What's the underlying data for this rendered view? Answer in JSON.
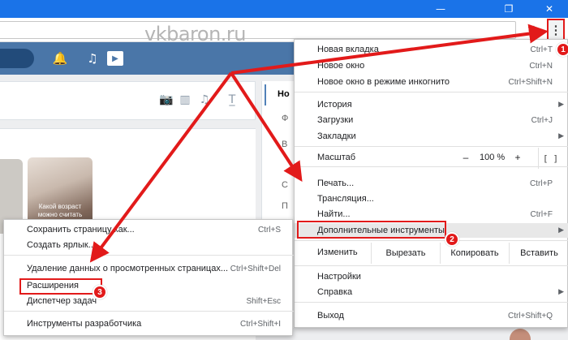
{
  "watermark": "vkbaron.ru",
  "window_controls": {
    "minimize": "—",
    "restore": "❐",
    "close": "✕"
  },
  "toolbar": {
    "star_icon": "☆",
    "menu_icon": "⋮"
  },
  "vk_header": {
    "bell_icon": "🔔",
    "music_icon": "♫",
    "video_icon": "▶"
  },
  "post_icons": [
    "📷",
    "▥",
    "♫",
    "T̲"
  ],
  "feed": {
    "thumbnail_caption": "Какой возраст можно считать оптимальным"
  },
  "right_column": {
    "tab_label": "Но",
    "letters": [
      "Ф",
      "В",
      "С",
      "П"
    ]
  },
  "main_menu": {
    "new_tab": {
      "label": "Новая вкладка",
      "shortcut": "Ctrl+T"
    },
    "new_window": {
      "label": "Новое окно",
      "shortcut": "Ctrl+N"
    },
    "incognito": {
      "label": "Новое окно в режиме инкогнито",
      "shortcut": "Ctrl+Shift+N"
    },
    "history": {
      "label": "История"
    },
    "downloads": {
      "label": "Загрузки",
      "shortcut": "Ctrl+J"
    },
    "bookmarks": {
      "label": "Закладки"
    },
    "zoom": {
      "label": "Масштаб",
      "minus": "–",
      "value": "100 %",
      "plus": "+",
      "fullscreen_icon": "[ ]"
    },
    "print": {
      "label": "Печать...",
      "shortcut": "Ctrl+P"
    },
    "cast": {
      "label": "Трансляция..."
    },
    "find": {
      "label": "Найти...",
      "shortcut": "Ctrl+F"
    },
    "more_tools": {
      "label": "Дополнительные инструменты"
    },
    "edit": {
      "label": "Изменить",
      "cut": "Вырезать",
      "copy": "Копировать",
      "paste": "Вставить"
    },
    "settings": {
      "label": "Настройки"
    },
    "help": {
      "label": "Справка"
    },
    "exit": {
      "label": "Выход",
      "shortcut": "Ctrl+Shift+Q"
    },
    "arrow": "▶"
  },
  "sub_menu": {
    "save_page": {
      "label": "Сохранить страницу как...",
      "shortcut": "Ctrl+S"
    },
    "create_shortcut": {
      "label": "Создать ярлык..."
    },
    "clear_data": {
      "label": "Удаление данных о просмотренных страницах...",
      "shortcut": "Ctrl+Shift+Del"
    },
    "extensions": {
      "label": "Расширения"
    },
    "task_manager": {
      "label": "Диспетчер задач",
      "shortcut": "Shift+Esc"
    },
    "dev_tools": {
      "label": "Инструменты разработчика",
      "shortcut": "Ctrl+Shift+I"
    }
  },
  "badges": {
    "step1": "1",
    "step2": "2",
    "step3": "3"
  },
  "colors": {
    "titlebar": "#1a73e8",
    "vk_header": "#4a76a8",
    "annotation_red": "#e21a1a"
  }
}
